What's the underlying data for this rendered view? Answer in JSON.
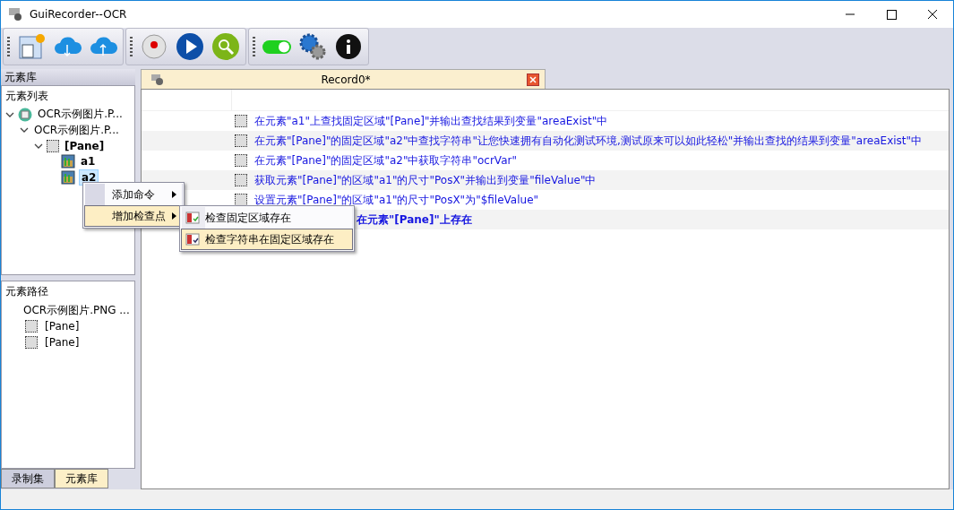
{
  "window": {
    "title": "GuiRecorder--OCR"
  },
  "left_panel": {
    "title": "元素库",
    "element_list": {
      "title": "元素列表",
      "tree": [
        {
          "kind": "app",
          "label": "OCR示例图片.P...",
          "selected": false,
          "expanded": true,
          "children": [
            {
              "label": "OCR示例图片.P...",
              "selected": false,
              "expanded": true,
              "children": [
                {
                  "kind": "pane",
                  "label": "[Pane]",
                  "selected": false,
                  "expanded": true,
                  "children": [
                    {
                      "kind": "image",
                      "label": "a1",
                      "selected": false
                    },
                    {
                      "kind": "image",
                      "label": "a2",
                      "selected": true
                    }
                  ]
                }
              ]
            }
          ]
        }
      ]
    },
    "element_path": {
      "title": "元素路径",
      "items": [
        {
          "kind": "text",
          "label": "OCR示例图片.PNG ..."
        },
        {
          "kind": "pane",
          "label": "[Pane]"
        },
        {
          "kind": "pane",
          "label": "[Pane]"
        }
      ]
    },
    "tabs": [
      {
        "label": "录制集",
        "selected": false
      },
      {
        "label": "元素库",
        "selected": true
      }
    ]
  },
  "document": {
    "tab_title": "Record0*",
    "commands": [
      {
        "kind": "full",
        "checked": false,
        "text": "在元素\"a1\"上查找固定区域\"[Pane]\"并输出查找结果到变量\"areaExist\"中"
      },
      {
        "kind": "full",
        "checked": false,
        "text": "在元素\"[Pane]\"的固定区域\"a2\"中查找字符串\"让您快速拥有自动化测试环境,测试原来可以如此轻松\"并输出查找的结果到变量\"areaExist\"中"
      },
      {
        "kind": "full",
        "checked": false,
        "text": "在元素\"[Pane]\"的固定区域\"a2\"中获取字符串\"ocrVar\""
      },
      {
        "kind": "full",
        "checked": false,
        "text": "获取元素\"[Pane]\"的区域\"a1\"的尺寸\"PosX\"并输出到变量\"fileValue\"中"
      },
      {
        "kind": "full",
        "checked": false,
        "text": "设置元素\"[Pane]\"的区域\"a1\"的尺寸\"PosX\"为\"$fileValue\""
      },
      {
        "kind": "covered",
        "text": "在元素\"[Pane]\"上存在"
      }
    ]
  },
  "context_menu": {
    "items": [
      {
        "label": "添加命令",
        "selected": false
      },
      {
        "label": "增加检查点",
        "selected": true
      }
    ],
    "submenu": [
      {
        "label": "检查固定区域存在",
        "selected": false
      },
      {
        "label": "检查字符串在固定区域存在",
        "selected": true
      }
    ]
  }
}
